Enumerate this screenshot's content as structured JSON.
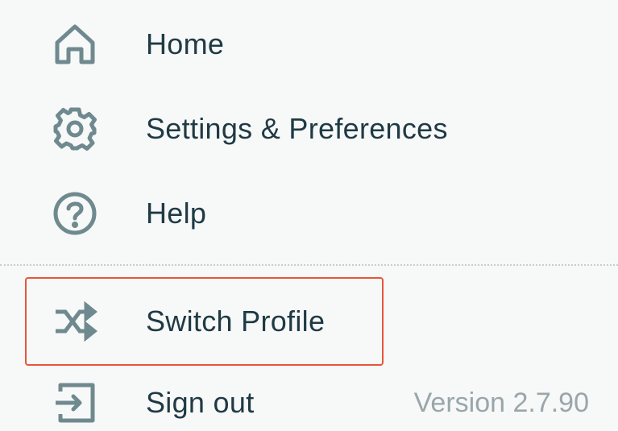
{
  "menu": {
    "items": [
      {
        "label": "Home",
        "icon": "home-icon"
      },
      {
        "label": "Settings & Preferences",
        "icon": "gear-icon"
      },
      {
        "label": "Help",
        "icon": "help-icon"
      },
      {
        "label": "Switch Profile",
        "icon": "shuffle-icon"
      },
      {
        "label": "Sign out",
        "icon": "sign-out-icon"
      }
    ],
    "version": "Version 2.7.90"
  },
  "colors": {
    "background": "#f7f8f8",
    "text": "#1f3a44",
    "icon": "#6f8a8f",
    "highlight_border": "#e8563a",
    "version_text": "#9aa6aa"
  }
}
